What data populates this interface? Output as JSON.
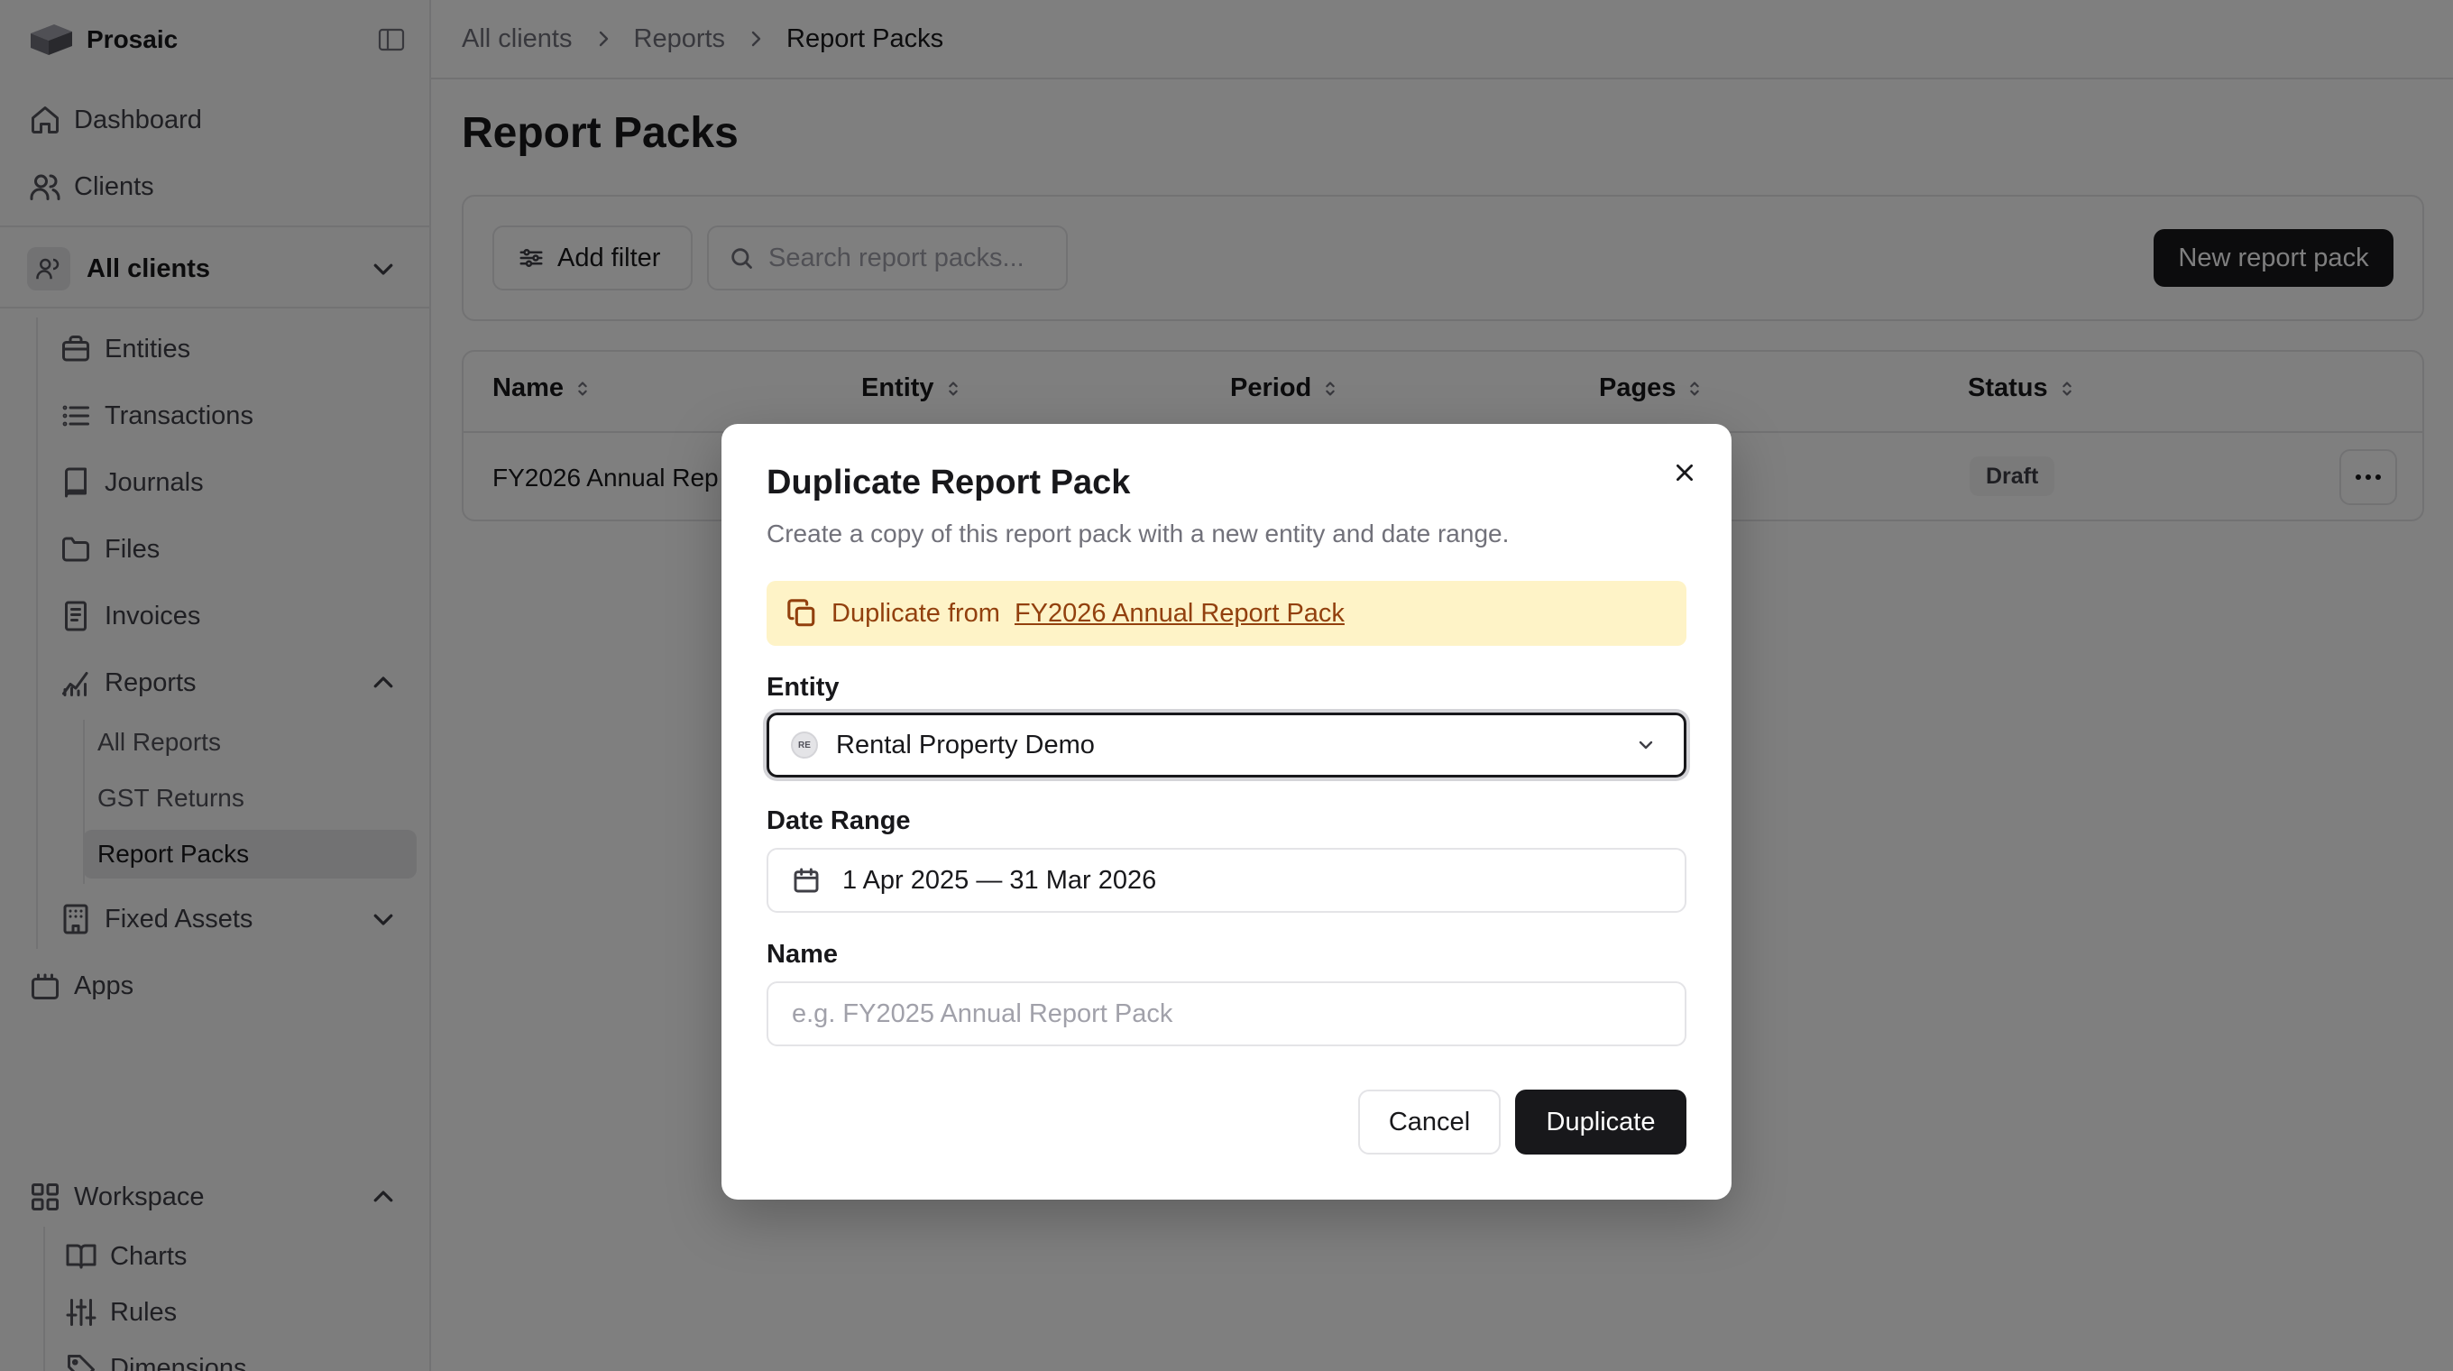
{
  "app": {
    "name": "Prosaic"
  },
  "sidebar": {
    "nav": {
      "dashboard": "Dashboard",
      "clients": "Clients",
      "apps": "Apps"
    },
    "client_switcher": {
      "label": "All clients"
    },
    "client_items": {
      "entities": "Entities",
      "transactions": "Transactions",
      "journals": "Journals",
      "files": "Files",
      "invoices": "Invoices",
      "reports": "Reports",
      "fixed_assets": "Fixed Assets"
    },
    "reports_children": {
      "all_reports": "All Reports",
      "gst_returns": "GST Returns",
      "report_packs": "Report Packs"
    },
    "workspace": {
      "label": "Workspace",
      "charts": "Charts",
      "rules": "Rules",
      "dimensions": "Dimensions"
    }
  },
  "breadcrumb": [
    "All clients",
    "Reports",
    "Report Packs"
  ],
  "page": {
    "title": "Report Packs",
    "add_filter": "Add filter",
    "search_placeholder": "Search report packs...",
    "new_button": "New report pack"
  },
  "table": {
    "columns": [
      "Name",
      "Entity",
      "Period",
      "Pages",
      "Status"
    ],
    "rows": [
      {
        "name": "FY2026 Annual Rep",
        "status": "Draft"
      }
    ]
  },
  "dialog": {
    "title": "Duplicate Report Pack",
    "description": "Create a copy of this report pack with a new entity and date range.",
    "duplicate_from_label": "Duplicate from",
    "duplicate_from_name": "FY2026 Annual Report Pack",
    "entity_label": "Entity",
    "entity_badge": "RE",
    "entity_value": "Rental Property Demo",
    "date_label": "Date Range",
    "date_value": "1 Apr 2025 — 31 Mar 2026",
    "name_label": "Name",
    "name_placeholder": "e.g. FY2025 Annual Report Pack",
    "cancel": "Cancel",
    "submit": "Duplicate"
  }
}
